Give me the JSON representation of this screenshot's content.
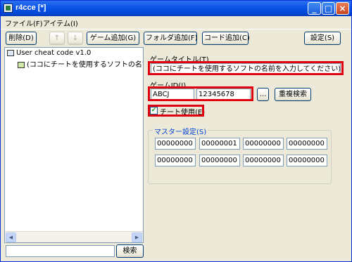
{
  "window": {
    "title": "r4cce [*]"
  },
  "menu": {
    "items": [
      "ファイル(F)",
      "アイテム(I)"
    ]
  },
  "toolbar": {
    "delete_label": "削除(D)",
    "up_label": "↑",
    "down_label": "↓",
    "add_game_label": "ゲーム追加(G)",
    "add_folder_label": "フォルダ追加(F)",
    "add_code_label": "コード追加(C)",
    "settings_label": "設定(S)"
  },
  "tree": {
    "root_label": "User cheat code v1.0",
    "child_label": "(ココにチートを使用するソフトの名前を"
  },
  "search": {
    "button_label": "検索",
    "value": ""
  },
  "form": {
    "game_title_label": "ゲームタイトル(T)",
    "game_title_value": "(ココにチートを使用するソフトの名前を入力してください)",
    "game_id_label": "ゲームID(I)",
    "game_id_code": "ABCJ",
    "game_id_number": "12345678",
    "browse_label": "...",
    "duplicate_search_label": "重複検索",
    "cheat_enable_label": "チート使用(E)",
    "cheat_enable_checked": true,
    "master_label": "マスター設定(S)",
    "master_values": [
      "00000000",
      "00000001",
      "00000000",
      "00000000",
      "00000000",
      "00000000",
      "00000000",
      "00000000"
    ]
  },
  "colors": {
    "highlight": "#e0000f",
    "titlebar": "#0a54e4"
  }
}
